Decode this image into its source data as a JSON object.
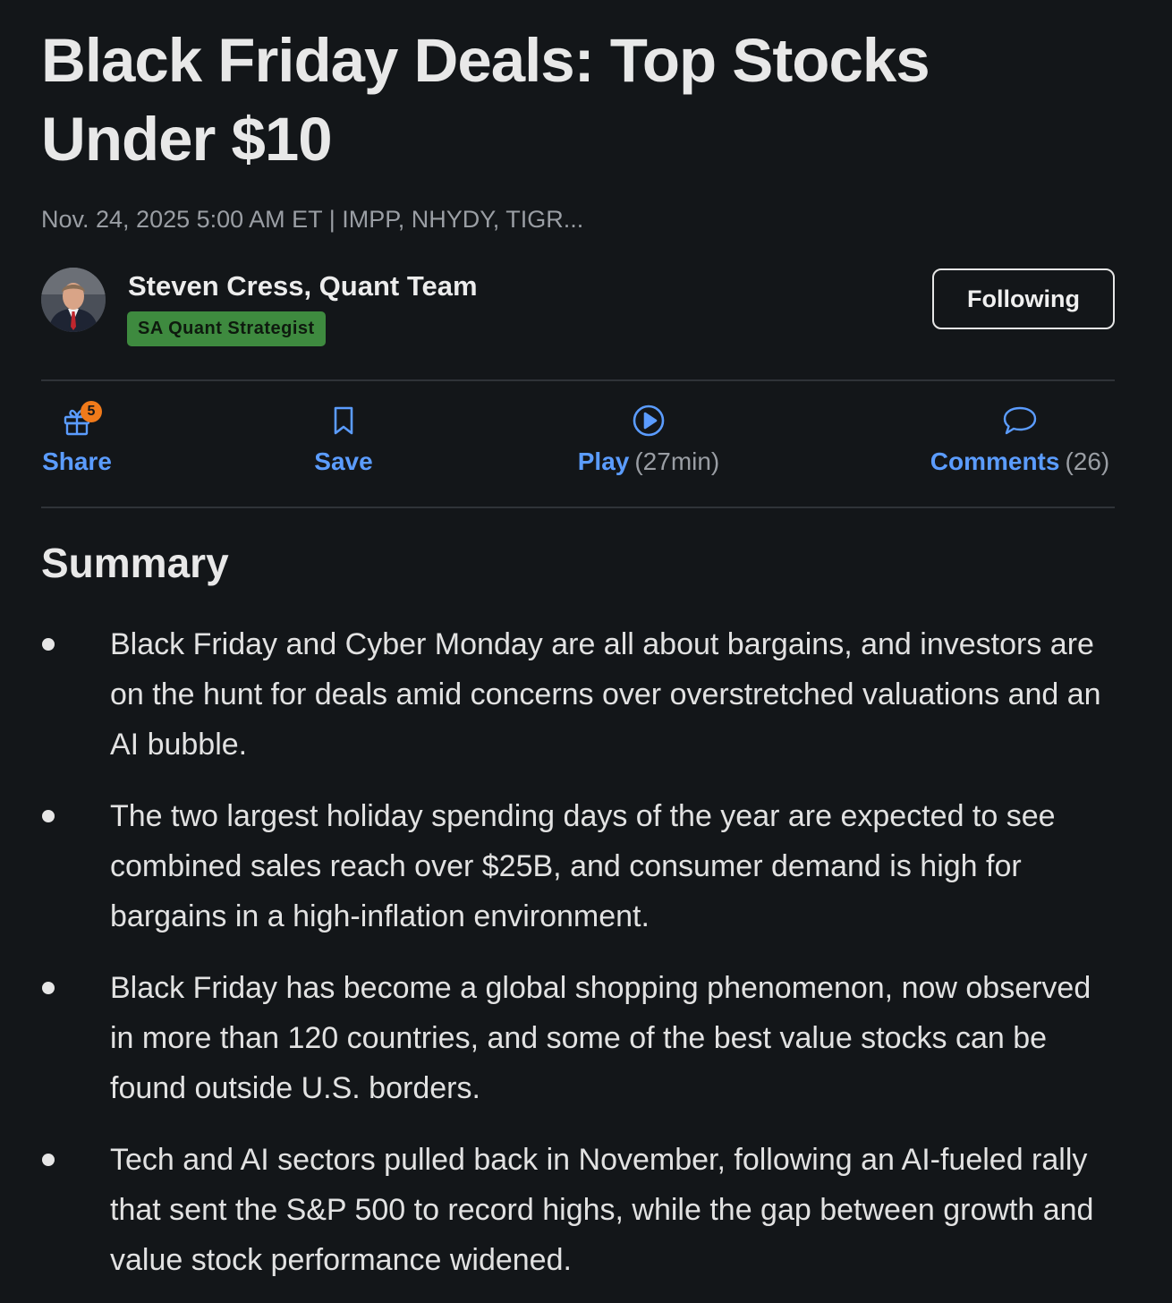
{
  "article": {
    "title": "Black Friday Deals: Top Stocks Under $10",
    "meta": "Nov. 24, 2025 5:00 AM ET | IMPP, NHYDY, TIGR..."
  },
  "author": {
    "name": "Steven Cress, Quant Team",
    "badge": "SA Quant Strategist",
    "follow_label": "Following"
  },
  "actions": {
    "share": {
      "label": "Share",
      "badge_count": "5"
    },
    "save": {
      "label": "Save"
    },
    "play": {
      "label": "Play",
      "duration": "(27min)"
    },
    "comments": {
      "label": "Comments",
      "count": "(26)"
    }
  },
  "summary": {
    "heading": "Summary",
    "items": [
      "Black Friday and Cyber Monday are all about bargains, and investors are on the hunt for deals amid concerns over overstretched valuations and an AI bubble.",
      "The two largest holiday spending days of the year are expected to see combined sales reach over $25B, and consumer demand is high for bargains in a high-inflation environment.",
      "Black Friday has become a global shopping phenomenon, now observed in more than 120 countries, and some of the best value stocks can be found outside U.S. borders.",
      "Tech and AI sectors pulled back in November, following an AI-fueled rally that sent the S&P 500 to record highs, while the gap between growth and value stock performance widened."
    ]
  },
  "colors": {
    "background": "#131619",
    "accent_link": "#5b9cff",
    "badge_green": "#3e8a3f",
    "notification_orange": "#f07a1a"
  },
  "icons": {
    "share": "gift-icon",
    "save": "bookmark-icon",
    "play": "play-circle-icon",
    "comments": "speech-bubble-icon"
  }
}
